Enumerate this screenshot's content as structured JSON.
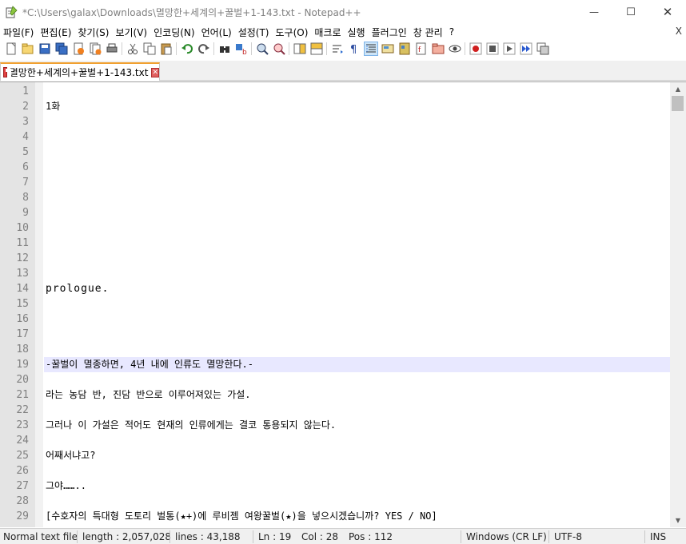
{
  "window": {
    "title": "*C:\\Users\\galax\\Downloads\\멸망한+세계의+꿀벌+1-143.txt - Notepad++",
    "minimize_glyph": "—",
    "maximize_glyph": "☐",
    "close_glyph": "✕"
  },
  "menu": {
    "items": [
      "파일(F)",
      "편집(E)",
      "찾기(S)",
      "보기(V)",
      "인코딩(N)",
      "언어(L)",
      "설정(T)",
      "도구(O)",
      "매크로",
      "실행",
      "플러그인",
      "창 관리",
      "?"
    ],
    "close_glyph": "X"
  },
  "toolbar": {
    "icons": [
      "new-file-icon",
      "open-file-icon",
      "save-icon",
      "save-all-icon",
      "close-icon",
      "close-all-icon",
      "print-icon",
      "cut-icon",
      "copy-icon",
      "paste-icon",
      "undo-icon",
      "redo-icon",
      "find-icon",
      "replace-icon",
      "zoom-in-icon",
      "zoom-out-icon",
      "sync-vertical-icon",
      "sync-horizontal-icon",
      "word-wrap-icon",
      "show-all-characters-icon",
      "indent-guide-icon",
      "user-language-icon",
      "document-map-icon",
      "function-list-icon",
      "folder-workspace-icon",
      "monitoring-icon",
      "record-macro-icon",
      "stop-macro-icon",
      "play-macro-icon",
      "run-macro-multiple-icon",
      "save-macro-icon"
    ]
  },
  "tab": {
    "label": "멸망한+세계의+꿀벌+1-143.txt",
    "close_glyph": "✕"
  },
  "editor": {
    "current_line": 19,
    "lines": [
      {
        "n": "1",
        "t": ""
      },
      {
        "n": "2",
        "t": "1화"
      },
      {
        "n": "3",
        "t": ""
      },
      {
        "n": "4",
        "t": ""
      },
      {
        "n": "5",
        "t": ""
      },
      {
        "n": "6",
        "t": ""
      },
      {
        "n": "7",
        "t": ""
      },
      {
        "n": "8",
        "t": ""
      },
      {
        "n": "9",
        "t": ""
      },
      {
        "n": "10",
        "t": ""
      },
      {
        "n": "11",
        "t": ""
      },
      {
        "n": "12",
        "t": ""
      },
      {
        "n": "13",
        "t": ""
      },
      {
        "n": "14",
        "t": "prologue."
      },
      {
        "n": "15",
        "t": ""
      },
      {
        "n": "16",
        "t": ""
      },
      {
        "n": "17",
        "t": ""
      },
      {
        "n": "18",
        "t": ""
      },
      {
        "n": "19",
        "t": "-꿀벌이 멸종하면, 4년 내에 인류도 멸망한다.-"
      },
      {
        "n": "20",
        "t": ""
      },
      {
        "n": "21",
        "t": "라는 농담 반, 진담 반으로 이루어져있는 가설."
      },
      {
        "n": "22",
        "t": ""
      },
      {
        "n": "23",
        "t": "그러나 이 가설은 적어도 현재의 인류에게는 결코 통용되지 않는다."
      },
      {
        "n": "24",
        "t": ""
      },
      {
        "n": "25",
        "t": "어째서냐고?"
      },
      {
        "n": "26",
        "t": ""
      },
      {
        "n": "27",
        "t": "그야…….."
      },
      {
        "n": "28",
        "t": ""
      },
      {
        "n": "29",
        "t": "[수호자의 특대형 도토리 벌통(★+)에 루비젬 여왕꿀벌(★)을 넣으시겠습니까? YES / NO]"
      }
    ]
  },
  "scrollbar": {
    "up_glyph": "▲",
    "down_glyph": "▼"
  },
  "status": {
    "file_type": "Normal text file",
    "length": "length : 2,057,028",
    "lines": "lines : 43,188",
    "ln": "Ln : 19",
    "col": "Col : 28",
    "pos": "Pos : 112",
    "eol": "Windows (CR LF)",
    "encoding": "UTF-8",
    "mode": "INS"
  }
}
